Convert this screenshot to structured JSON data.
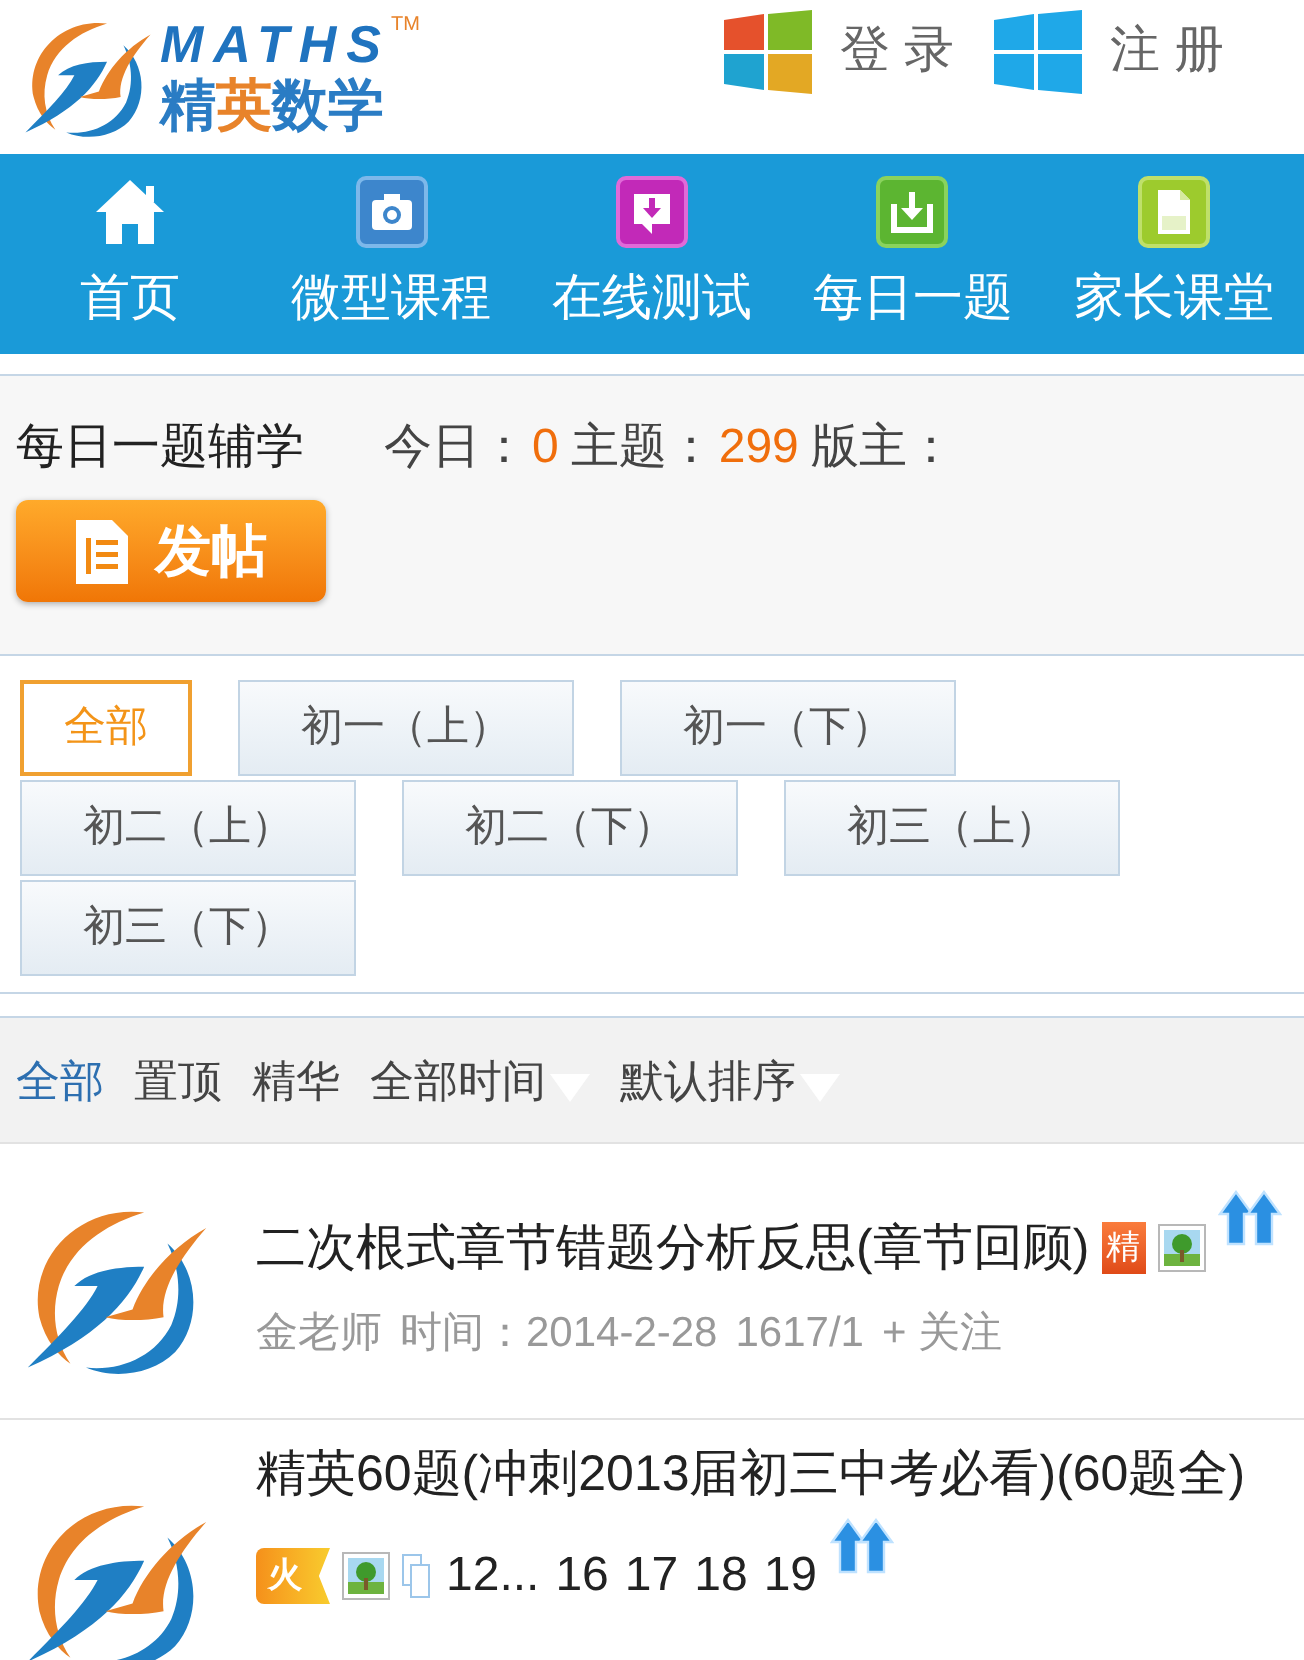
{
  "header": {
    "logo": {
      "wordmark": "MATHS",
      "trademark": "TM",
      "name": "精英数学"
    },
    "account_links": [
      {
        "kind": "multicolor",
        "label": "登 录"
      },
      {
        "kind": "blue",
        "label": "注 册"
      }
    ]
  },
  "nav": [
    {
      "kind": "home",
      "label": "首页"
    },
    {
      "kind": "camera",
      "label": "微型课程"
    },
    {
      "kind": "test",
      "label": "在线测试"
    },
    {
      "kind": "download",
      "label": "每日一题"
    },
    {
      "kind": "document",
      "label": "家长课堂"
    }
  ],
  "forum": {
    "title": "每日一题辅学",
    "stats": [
      {
        "label": "今日：",
        "value": "0"
      },
      {
        "label": "主题：",
        "value": "299"
      },
      {
        "label": "版主："
      }
    ],
    "post_button": "发帖"
  },
  "categories": [
    {
      "label": "全部",
      "selected": true
    },
    {
      "label": "初一（上）",
      "selected": false
    },
    {
      "label": "初一（下）",
      "selected": false
    },
    {
      "label": "初二（上）",
      "selected": false
    },
    {
      "label": "初二（下）",
      "selected": false
    },
    {
      "label": "初三（上）",
      "selected": false
    },
    {
      "label": "初三（下）",
      "selected": false
    }
  ],
  "filters": [
    {
      "kind": "link",
      "label": "全部",
      "selected": true
    },
    {
      "kind": "link",
      "label": "置顶",
      "selected": false
    },
    {
      "kind": "link",
      "label": "精华",
      "selected": false
    },
    {
      "kind": "dropdown",
      "label": "全部时间",
      "selected": false
    },
    {
      "kind": "dropdown",
      "label": "默认排序",
      "selected": false
    }
  ],
  "threads": [
    {
      "title": "二次根式章节错题分析反思(章节回顾)",
      "badges": [
        {
          "kind": "digest",
          "text": "精"
        },
        {
          "kind": "image"
        }
      ],
      "up_icon": true,
      "author": "金老师",
      "time_label": "时间：",
      "date": "2014-2-28",
      "counts": "1617/1",
      "follow": "+ 关注"
    },
    {
      "title": "精英60题(冲刺2013届初三中考必看)(60题全)",
      "badges": [
        {
          "kind": "hot",
          "text": "火"
        },
        {
          "kind": "image"
        },
        {
          "kind": "multipage"
        }
      ],
      "pages": [
        "12...",
        "16",
        "17",
        "18",
        "19"
      ],
      "up_icon": true
    }
  ]
}
